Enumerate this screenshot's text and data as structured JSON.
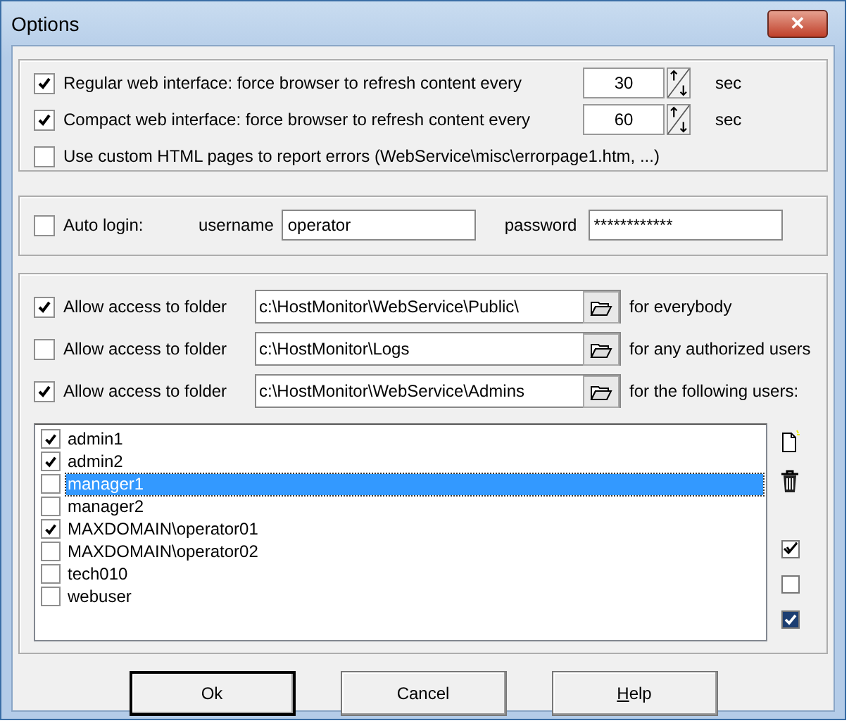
{
  "window": {
    "title": "Options",
    "close_label": "✕"
  },
  "refresh": [
    {
      "checked": true,
      "label": "Regular  web interface: force browser to refresh content every",
      "value": "30",
      "unit": "sec"
    },
    {
      "checked": true,
      "label": "Compact web interface: force browser to refresh content every",
      "value": "60",
      "unit": "sec"
    }
  ],
  "custom_errors": {
    "checked": false,
    "label": "Use custom HTML pages to report errors (WebService\\misc\\errorpage1.htm, ...)"
  },
  "auto_login": {
    "checked": false,
    "label": "Auto login:",
    "username_label": "username",
    "username": "operator",
    "password_label": "password",
    "password": "************"
  },
  "folders": [
    {
      "checked": true,
      "label": "Allow access to folder",
      "path": "c:\\HostMonitor\\WebService\\Public\\",
      "scope": "for everybody"
    },
    {
      "checked": false,
      "label": "Allow access to folder",
      "path": "c:\\HostMonitor\\Logs",
      "scope": "for any authorized users"
    },
    {
      "checked": true,
      "label": "Allow access to folder",
      "path": "c:\\HostMonitor\\WebService\\Admins",
      "scope": "for the following users:"
    }
  ],
  "users": [
    {
      "name": "admin1",
      "checked": true,
      "selected": false
    },
    {
      "name": "admin2",
      "checked": true,
      "selected": false
    },
    {
      "name": "manager1",
      "checked": false,
      "selected": true
    },
    {
      "name": "manager2",
      "checked": false,
      "selected": false
    },
    {
      "name": "MAXDOMAIN\\operator01",
      "checked": true,
      "selected": false
    },
    {
      "name": "MAXDOMAIN\\operator02",
      "checked": false,
      "selected": false
    },
    {
      "name": "tech010",
      "checked": false,
      "selected": false
    },
    {
      "name": "webuser",
      "checked": false,
      "selected": false
    }
  ],
  "buttons": [
    {
      "label": "Ok",
      "default": true,
      "underline_first": false
    },
    {
      "label": "Cancel",
      "default": false,
      "underline_first": false
    },
    {
      "label": "Help",
      "default": false,
      "underline_first": true
    }
  ]
}
